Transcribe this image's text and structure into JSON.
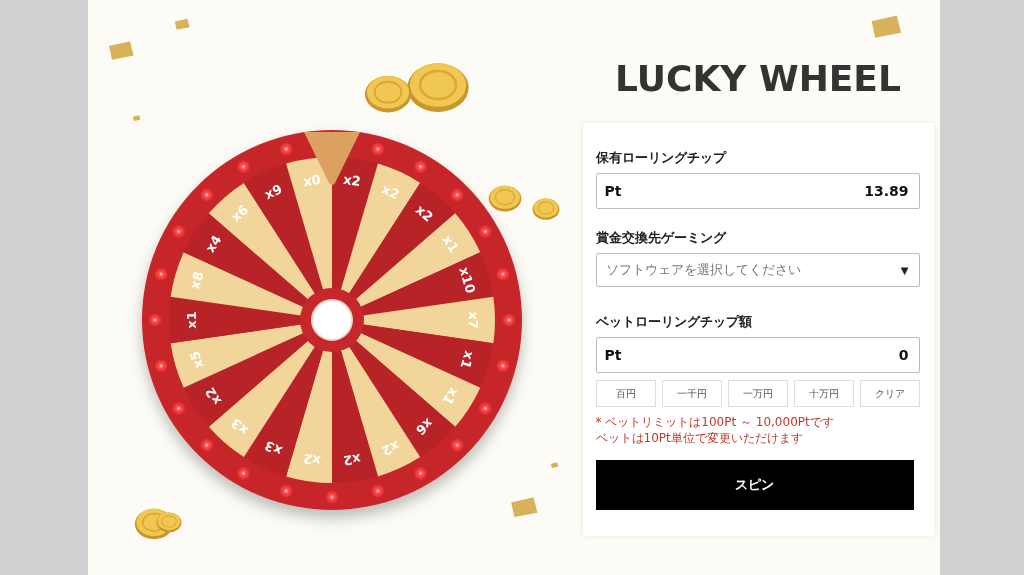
{
  "wheel": {
    "segments": [
      {
        "label": "x2"
      },
      {
        "label": "x2"
      },
      {
        "label": "x2"
      },
      {
        "label": "x1"
      },
      {
        "label": "x10"
      },
      {
        "label": "x7"
      },
      {
        "label": "x1"
      },
      {
        "label": "x1"
      },
      {
        "label": "x6"
      },
      {
        "label": "x2"
      },
      {
        "label": "x2"
      },
      {
        "label": "x2"
      },
      {
        "label": "x3"
      },
      {
        "label": "x3"
      },
      {
        "label": "x2"
      },
      {
        "label": "x5"
      },
      {
        "label": "x1"
      },
      {
        "label": "x8"
      },
      {
        "label": "x4"
      },
      {
        "label": "x6"
      },
      {
        "label": "x9"
      },
      {
        "label": "x0"
      }
    ]
  },
  "title": "LUCKY WHEEL",
  "form": {
    "holding": {
      "label": "保有ローリングチップ",
      "unit": "Pt",
      "value": "13.89"
    },
    "exchange": {
      "label": "賞金交換先ゲーミング",
      "placeholder": "ソフトウェアを選択してください",
      "caret": "▼"
    },
    "bet": {
      "label": "ベットローリングチップ額",
      "unit": "Pt",
      "value": "0",
      "quick_amounts": [
        "百円",
        "一千円",
        "一万円",
        "十万円",
        "クリア"
      ],
      "notes": [
        "* ベットリミットは100Pt ～ 10,000Ptです",
        "ベットは10Pt単位で変更いただけます"
      ]
    },
    "spin_button": "スピン"
  }
}
